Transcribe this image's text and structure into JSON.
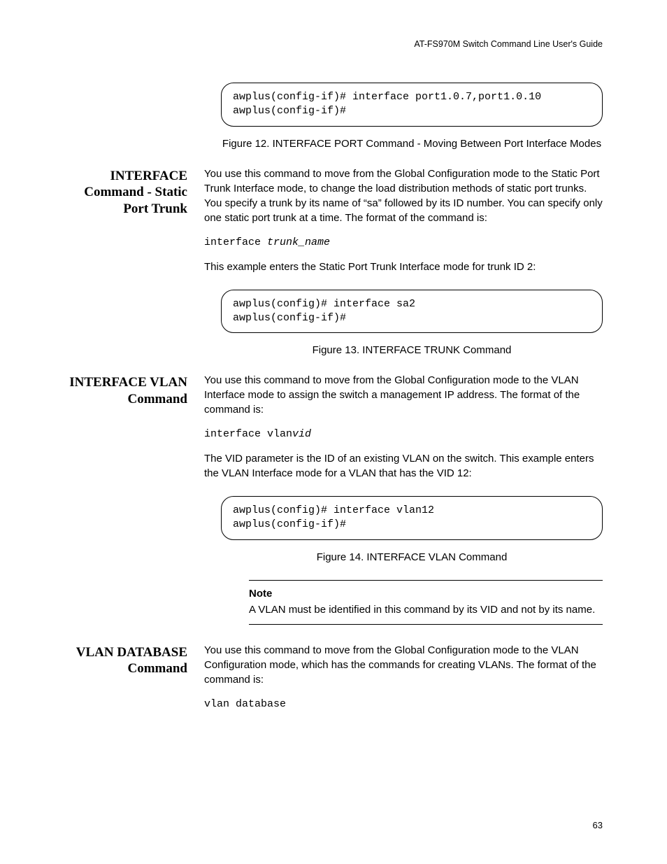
{
  "header": "AT-FS970M Switch Command Line User's Guide",
  "codebox1": "awplus(config-if)# interface port1.0.7,port1.0.10\nawplus(config-if)#",
  "figcap1": "Figure 12. INTERFACE PORT Command - Moving Between Port Interface Modes",
  "section1": {
    "heading": "INTERFACE Command - Static Port Trunk",
    "p1": "You use this command to move from the Global Configuration mode to the Static Port Trunk Interface mode, to change the load distribution methods of static port trunks. You specify a trunk by its name of “sa” followed by its ID number. You can specify only one static port trunk at a time. The format of the command is:",
    "cmd_prefix": "interface ",
    "cmd_italic": "trunk_name",
    "p2": "This example enters the Static Port Trunk Interface mode for trunk ID 2:"
  },
  "codebox2": "awplus(config)# interface sa2\nawplus(config-if)#",
  "figcap2": "Figure 13. INTERFACE TRUNK Command",
  "section2": {
    "heading": "INTERFACE VLAN Command",
    "p1": "You use this command to move from the Global Configuration mode to the VLAN Interface mode to assign the switch a management IP address. The format of the command is:",
    "cmd_prefix": "interface vlan",
    "cmd_italic": "vid",
    "p2": "The VID parameter is the ID of an existing VLAN on the switch. This example enters the VLAN Interface mode for a VLAN that has the VID 12:"
  },
  "codebox3": "awplus(config)# interface vlan12\nawplus(config-if)#",
  "figcap3": "Figure 14. INTERFACE VLAN Command",
  "note": {
    "label": "Note",
    "text": "A VLAN must be identified in this command by its VID and not by its name."
  },
  "section3": {
    "heading": "VLAN DATABASE Command",
    "p1": "You use this command to move from the Global Configuration mode to the VLAN Configuration mode, which has the commands for creating VLANs. The format of the command is:",
    "cmd": "vlan database"
  },
  "page_number": "63"
}
